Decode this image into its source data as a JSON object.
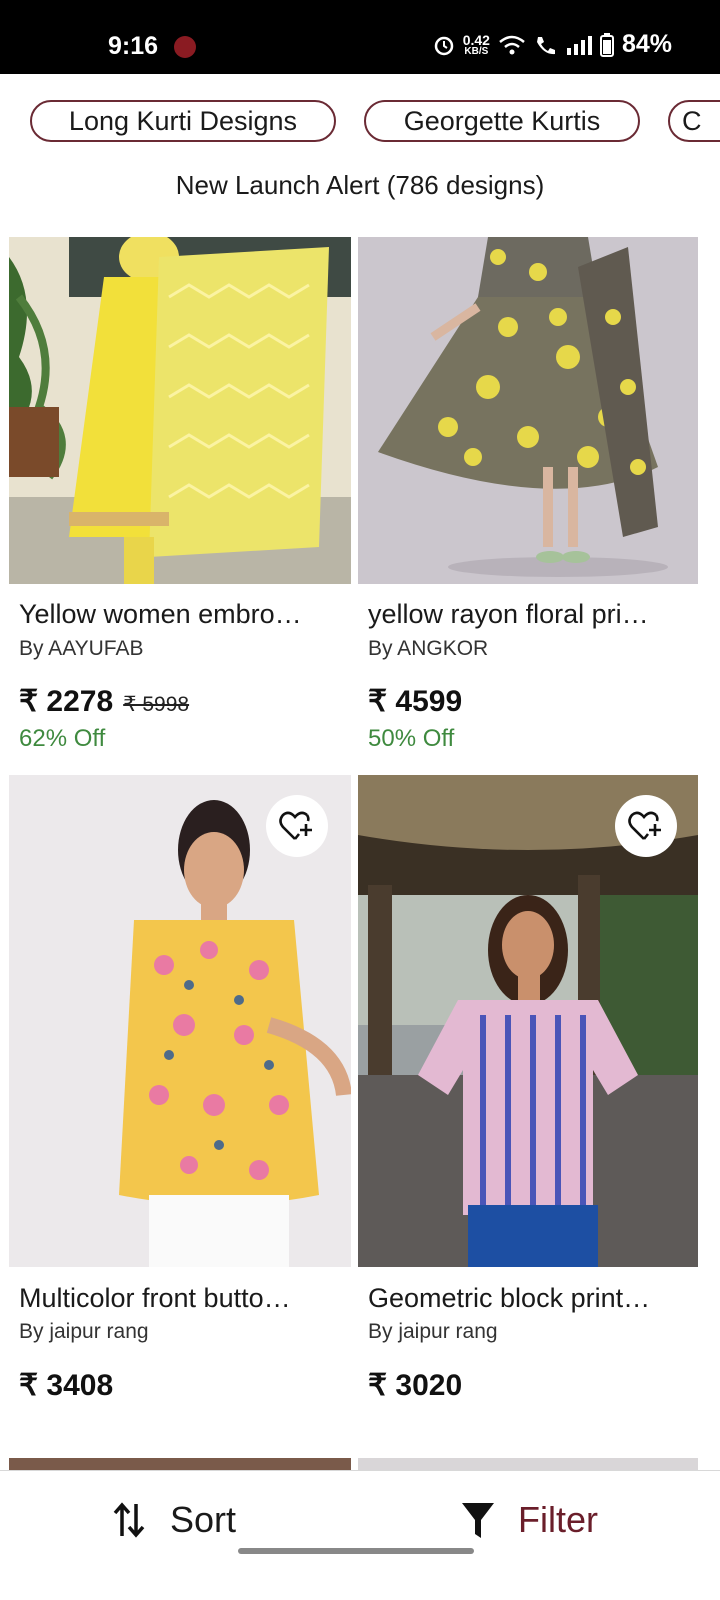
{
  "status_bar": {
    "time": "9:16",
    "net_speed": "0.42",
    "net_unit": "KB/S",
    "battery": "84%"
  },
  "chips": [
    {
      "label": "Long Kurti Designs"
    },
    {
      "label": "Georgette Kurtis"
    },
    {
      "label": "C"
    }
  ],
  "listing": {
    "subtitle": "New Launch Alert  (786 designs)"
  },
  "products": [
    {
      "title": "Yellow women embro…",
      "brand": "By AAYUFAB",
      "price": "₹ 2278",
      "mrp": "₹ 5998",
      "off": "62% Off"
    },
    {
      "title": "yellow rayon floral pri…",
      "brand": "By ANGKOR",
      "price": "₹ 4599",
      "mrp": "",
      "off": "50% Off"
    },
    {
      "title": "Multicolor front butto…",
      "brand": "By jaipur rang",
      "price": "₹ 3408",
      "mrp": "",
      "off": ""
    },
    {
      "title": "Geometric block print…",
      "brand": "By jaipur rang",
      "price": "₹ 3020",
      "mrp": "",
      "off": ""
    }
  ],
  "bottom_bar": {
    "sort_label": "Sort",
    "filter_label": "Filter"
  },
  "colors": {
    "accent": "#6a1e2a",
    "discount": "#3f8a3f"
  },
  "icons": [
    "alarm-icon",
    "wifi-icon",
    "wifi-call-icon",
    "signal-icon",
    "battery-icon",
    "heart-plus-icon",
    "sort-icon",
    "filter-icon"
  ]
}
